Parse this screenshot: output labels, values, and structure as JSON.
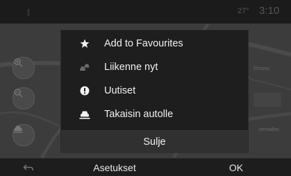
{
  "status_bar": {
    "temperature": "27°",
    "time": "3:10",
    "nav_icon": "compass-icon"
  },
  "map": {
    "labels": [
      "Chrono",
      "Versailles"
    ],
    "zoom_in_icon": "zoom-in-icon",
    "zoom_out_icon": "zoom-out-icon",
    "vehicle_icon": "car-icon"
  },
  "menu": {
    "items": [
      {
        "label": "Add to Favourites",
        "icon": "star-icon",
        "enabled": true
      },
      {
        "label": "Liikenne nyt",
        "icon": "traffic-icon",
        "enabled": false
      },
      {
        "label": "Uutiset",
        "icon": "info-icon",
        "enabled": true
      },
      {
        "label": "Takaisin autolle",
        "icon": "car-icon",
        "enabled": true
      }
    ],
    "close_label": "Sulje"
  },
  "bottom_bar": {
    "back_icon": "back-arrow-icon",
    "settings_label": "Asetukset",
    "ok_label": "OK"
  },
  "colors": {
    "popup_background": "#1e1e1e",
    "close_button_background": "#303030",
    "disabled_icon": "#6a6a6a"
  }
}
